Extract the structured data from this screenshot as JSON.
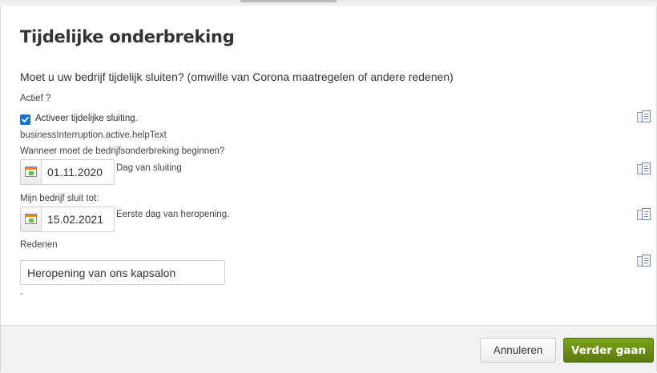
{
  "dialog": {
    "title": "Tijdelijke onderbreking",
    "question": "Moet u uw bedrijf tijdelijk sluiten? (omwille van Corona maatregelen of andere redenen)"
  },
  "active": {
    "label": "Actief ?",
    "checked": true,
    "checkbox_label": "Activeer tijdelijke sluiting.",
    "help_text": "businessInterruption.active.helpText"
  },
  "start": {
    "label": "Wanneer moet de bedrijfsonderbreking beginnen?",
    "value": "01.11.2020",
    "note": "Dag van sluiting"
  },
  "end": {
    "label": "Mijn bedrijf sluit tot:",
    "value": "15.02.2021",
    "note": "Eerste dag van heropening."
  },
  "reasons": {
    "label": "Redenen",
    "value": "Heropening van ons kapsalon",
    "extra": "-"
  },
  "icons": {
    "calendar": "calendar-icon",
    "translate": "translate-icon",
    "checkmark": "checkmark-icon"
  },
  "footer": {
    "cancel_label": "Annuleren",
    "next_label": "Verder gaan"
  },
  "colors": {
    "primary_button": "#6b8e12",
    "checkbox": "#0b74d8",
    "footer_bg": "#f1f1f1"
  }
}
